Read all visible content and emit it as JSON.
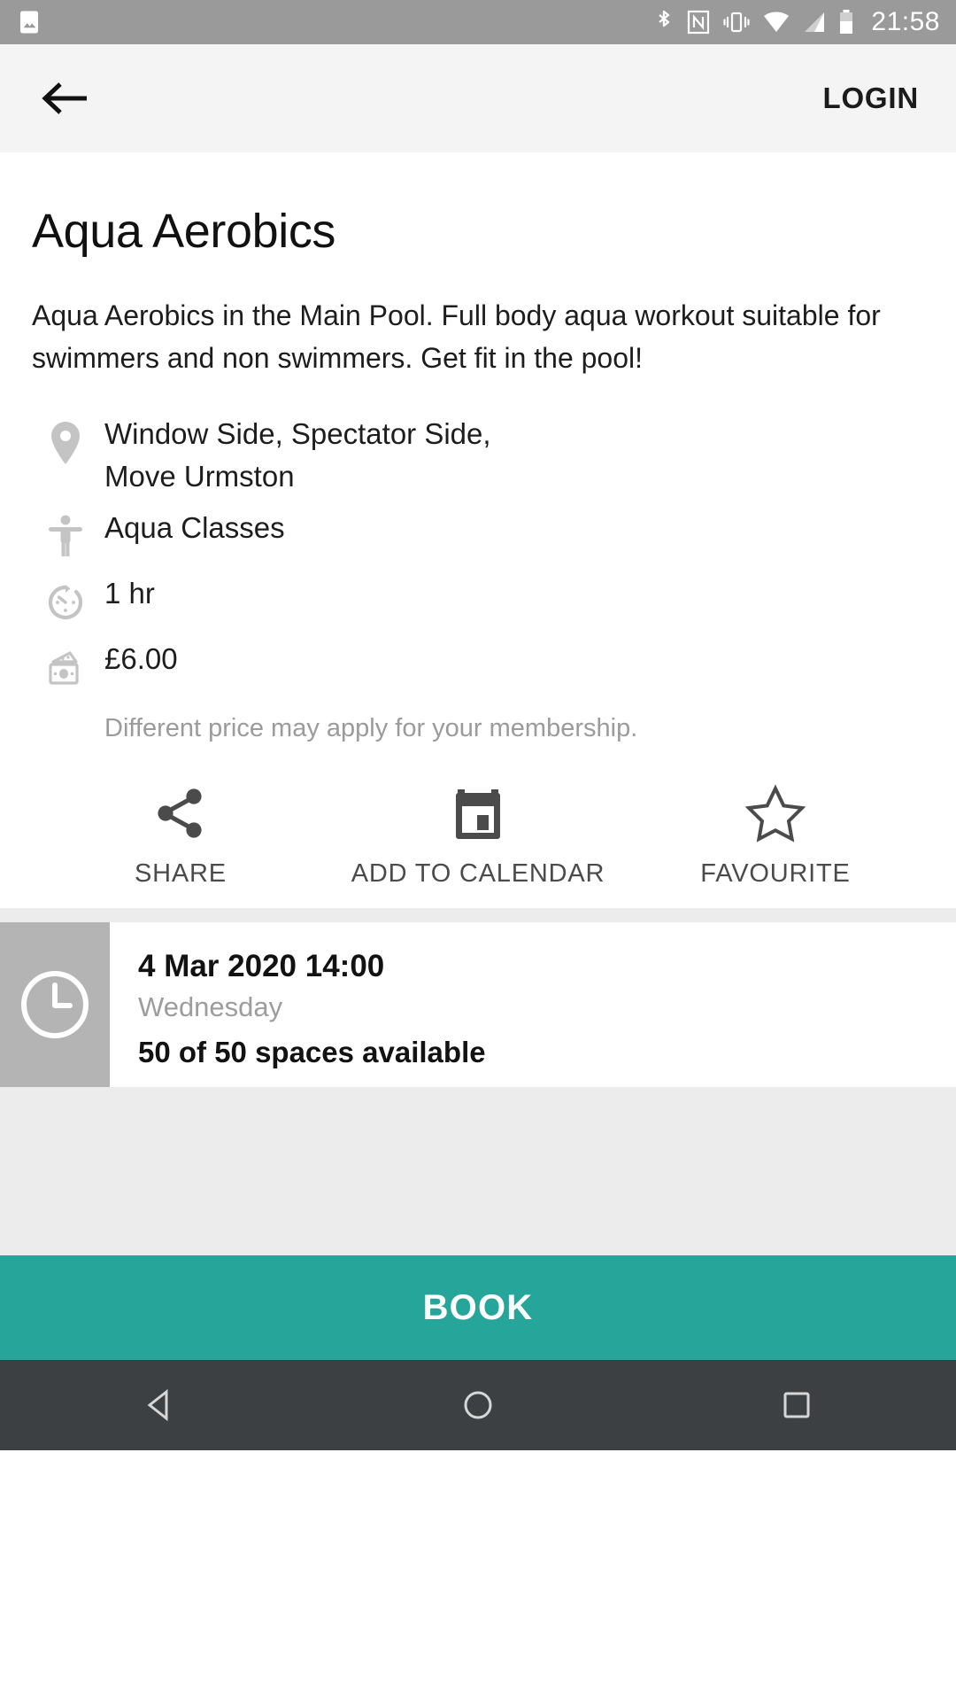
{
  "status_bar": {
    "time": "21:58",
    "icons": [
      "photo-icon",
      "bluetooth-icon",
      "nfc-icon",
      "vibrate-icon",
      "wifi-icon",
      "signal-icon",
      "battery-icon"
    ],
    "background": "#9a9a9a"
  },
  "app_bar": {
    "back_icon": "arrow-back-icon",
    "login_label": "LOGIN",
    "background": "#f4f4f4"
  },
  "activity": {
    "title": "Aqua Aerobics",
    "description": "Aqua Aerobics in the Main Pool. Full body aqua workout suitable for swimmers and non swimmers. Get fit in the pool!",
    "info_rows": [
      {
        "icon": "location-pin-icon",
        "text": "Window Side, Spectator Side,\nMove Urmston"
      },
      {
        "icon": "accessibility-person-icon",
        "text": "Aqua Classes"
      },
      {
        "icon": "timer-icon",
        "text": "1 hr"
      },
      {
        "icon": "money-icon",
        "text": "£6.00"
      }
    ],
    "price_note": "Different price may apply for your membership."
  },
  "actions": [
    {
      "icon": "share-icon",
      "label": "SHARE"
    },
    {
      "icon": "calendar-icon",
      "label": "ADD TO CALENDAR"
    },
    {
      "icon": "star-outline-icon",
      "label": "FAVOURITE"
    }
  ],
  "session": {
    "thumb_icon": "clock-icon",
    "date": "4 Mar 2020 14:00",
    "day": "Wednesday",
    "spaces": "50 of 50 spaces available"
  },
  "book": {
    "label": "BOOK",
    "color": "#26a69a"
  },
  "nav_bar": {
    "back_icon": "nav-back-triangle-icon",
    "home_icon": "nav-home-circle-icon",
    "recents_icon": "nav-recents-square-icon",
    "background": "#3c4043"
  }
}
